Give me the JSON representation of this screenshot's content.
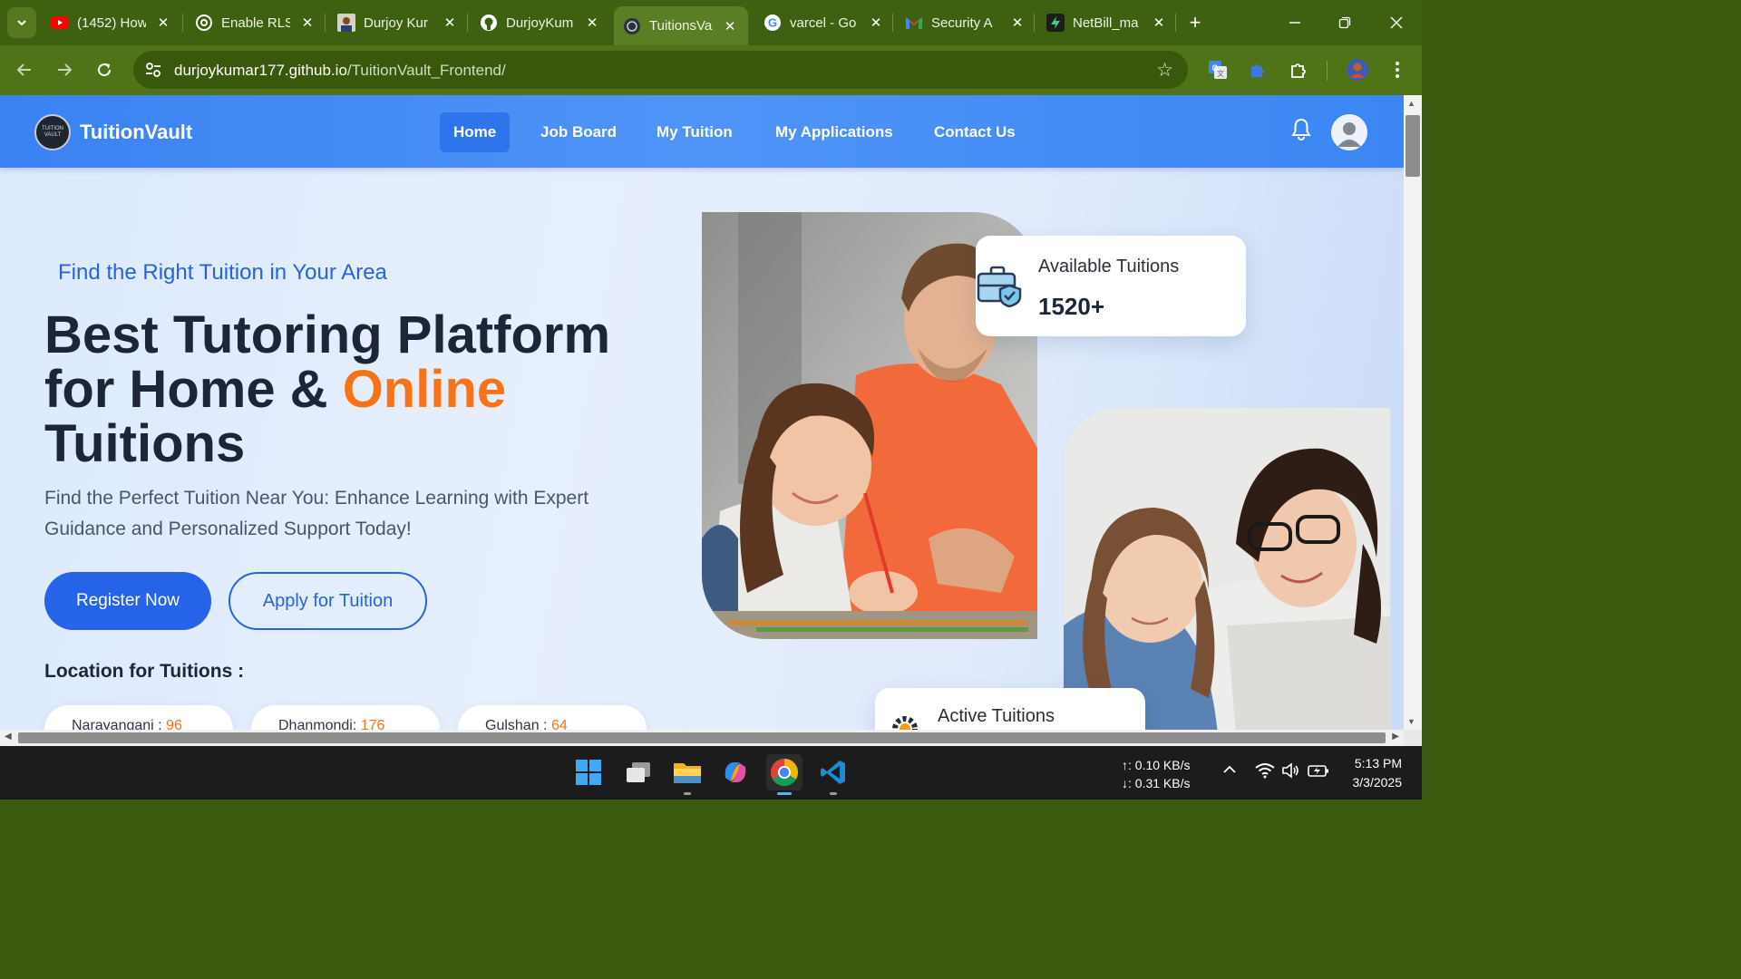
{
  "browser": {
    "tabs": [
      {
        "title": "(1452) How",
        "icon": "youtube-icon"
      },
      {
        "title": "Enable RLS",
        "icon": "openai-icon"
      },
      {
        "title": "Durjoy Kur",
        "icon": "profile-photo-icon"
      },
      {
        "title": "DurjoyKum",
        "icon": "github-icon"
      },
      {
        "title": "TuitionsVau",
        "icon": "site-logo-icon",
        "active": true
      },
      {
        "title": "varcel - Go",
        "icon": "google-icon"
      },
      {
        "title": "Security A",
        "icon": "gmail-icon"
      },
      {
        "title": "NetBill_ma",
        "icon": "supabase-icon"
      }
    ],
    "url_host": "durjoykumar177.github.io",
    "url_path": "/TuitionVault_Frontend/"
  },
  "site": {
    "logo_text": "TUITION VAULT",
    "brand": "TuitionVault",
    "nav": [
      "Home",
      "Job Board",
      "My Tuition",
      "My Applications",
      "Contact Us"
    ],
    "active_nav": "Home"
  },
  "hero": {
    "eyebrow": "Find the Right Tuition in Your Area",
    "title_part1": "Best Tutoring Platform for Home & ",
    "title_highlight": "Online",
    "title_part2": "Tuitions",
    "subtitle": "Find the Perfect Tuition Near You: Enhance Learning with Expert Guidance and Personalized Support Today!",
    "register_label": "Register Now",
    "apply_label": "Apply for Tuition",
    "locations_heading": "Location for Tuitions :",
    "locations": [
      {
        "name": "Narayanganj : ",
        "count": "96"
      },
      {
        "name": "Dhanmondi: ",
        "count": "176"
      },
      {
        "name": "Gulshan : ",
        "count": "64"
      }
    ]
  },
  "stats": {
    "available_label": "Available Tuitions",
    "available_value": "1520+",
    "active_label": "Active Tuitions"
  },
  "taskbar": {
    "upload": "↑: 0.10 KB/s",
    "download": "↓: 0.31 KB/s",
    "time": "5:13 PM",
    "date": "3/3/2025"
  },
  "colors": {
    "accent": "#2563e8",
    "highlight": "#f97316",
    "nav_bar": "#4a8ff5",
    "browser_frame": "#3d6110"
  }
}
